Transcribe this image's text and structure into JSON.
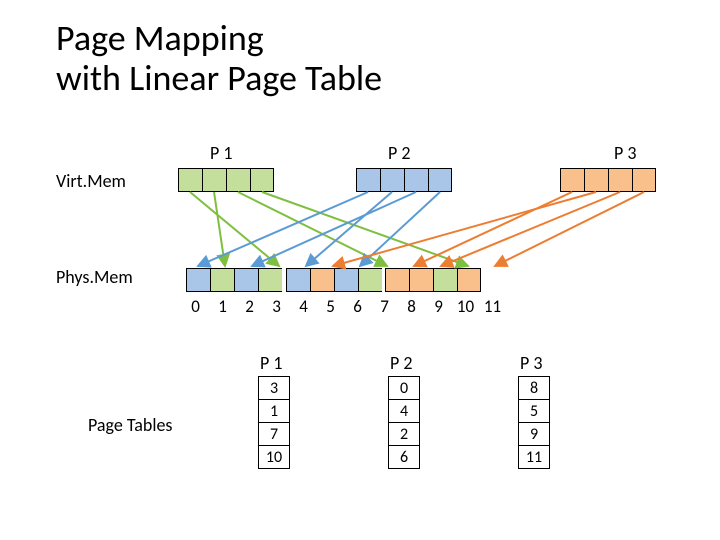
{
  "title_line1": "Page Mapping",
  "title_line2": "with Linear Page Table",
  "labels": {
    "virt": "Virt.Mem",
    "phys": "Phys.Mem",
    "page_tables": "Page Tables",
    "p1": "P 1",
    "p2": "P 2",
    "p3": "P 3"
  },
  "phys_indices": [
    "0",
    "1",
    "2",
    "3",
    "4",
    "5",
    "6",
    "7",
    "8",
    "9",
    "10",
    "11"
  ],
  "page_tables": {
    "p1": [
      "3",
      "1",
      "7",
      "10"
    ],
    "p2": [
      "0",
      "4",
      "2",
      "6"
    ],
    "p3": [
      "8",
      "5",
      "9",
      "11"
    ]
  },
  "colors": {
    "p1": "#7fbf3f",
    "p2": "#5b9bd5",
    "p3": "#ed7d31"
  },
  "chart_data": {
    "type": "table",
    "virt_processes": [
      {
        "name": "P1",
        "pages": 4,
        "color": "green"
      },
      {
        "name": "P2",
        "pages": 4,
        "color": "blue"
      },
      {
        "name": "P3",
        "pages": 4,
        "color": "orange"
      }
    ],
    "phys_layout": [
      "P2",
      "P1",
      "P2",
      "P1",
      "P2",
      "P3",
      "P2",
      "P1",
      "P3",
      "P3",
      "P1",
      "P3"
    ],
    "mappings": {
      "P1": [
        3,
        1,
        7,
        10
      ],
      "P2": [
        0,
        4,
        2,
        6
      ],
      "P3": [
        8,
        5,
        9,
        11
      ]
    }
  }
}
